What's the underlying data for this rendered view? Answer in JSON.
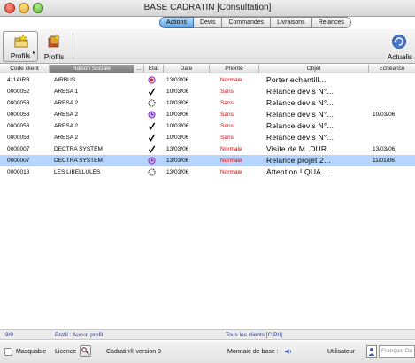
{
  "window": {
    "title": "BASE CADRATIN [Consultation]"
  },
  "tabs": [
    {
      "label": "Actions",
      "active": true
    },
    {
      "label": "Devis",
      "active": false
    },
    {
      "label": "Commandes",
      "active": false
    },
    {
      "label": "Livraisons",
      "active": false
    },
    {
      "label": "Relances",
      "active": false
    }
  ],
  "toolbar": {
    "profils_dropdown_label": "Profils",
    "profils_label": "Profils",
    "actualiser_label": "Actualis"
  },
  "table": {
    "columns": [
      "Code client",
      "Raison Sociale",
      "...",
      "Etat",
      "Date",
      "Priorité",
      "Objet",
      "Echéance"
    ],
    "rows": [
      {
        "code": "411AIRB",
        "raison": "AIRBUS",
        "etat": "clock-red",
        "date": "13/03/06",
        "priorite": "Normale",
        "objet": "Porter echantill...",
        "echeance": "",
        "selected": false
      },
      {
        "code": "0000052",
        "raison": "ARESA 1",
        "etat": "check",
        "date": "10/03/06",
        "priorite": "Sans",
        "objet": "Relance devis N°...",
        "echeance": "",
        "selected": false
      },
      {
        "code": "0000053",
        "raison": "ARESA 2",
        "etat": "clock",
        "date": "10/03/06",
        "priorite": "Sans",
        "objet": "Relance devis N°...",
        "echeance": "",
        "selected": false
      },
      {
        "code": "0000053",
        "raison": "ARESA 2",
        "etat": "clock-purple",
        "date": "10/03/06",
        "priorite": "Sans",
        "objet": "Relance devis N°...",
        "echeance": "10/03/06",
        "selected": false
      },
      {
        "code": "0000053",
        "raison": "ARESA 2",
        "etat": "check",
        "date": "10/03/06",
        "priorite": "Sans",
        "objet": "Relance devis N°...",
        "echeance": "",
        "selected": false
      },
      {
        "code": "0000053",
        "raison": "ARESA 2",
        "etat": "check",
        "date": "10/03/06",
        "priorite": "Sans",
        "objet": "Relance devis N°...",
        "echeance": "",
        "selected": false
      },
      {
        "code": "0000007",
        "raison": "DECTRA SYSTEM",
        "etat": "check",
        "date": "13/03/06",
        "priorite": "Normale",
        "objet": "Visite de M. DUR...",
        "echeance": "13/03/06",
        "selected": false
      },
      {
        "code": "0000007",
        "raison": "DECTRA SYSTEM",
        "etat": "clock-purple",
        "date": "13/03/06",
        "priorite": "Normale",
        "objet": "Relance projet 2...",
        "echeance": "11/01/06",
        "selected": true
      },
      {
        "code": "0000018",
        "raison": "LES LIBELLULES",
        "etat": "clock",
        "date": "13/03/06",
        "priorite": "Normale",
        "objet": "Attention ! QUA...",
        "echeance": "",
        "selected": false
      }
    ]
  },
  "status": {
    "count": "9/9",
    "profil": "Profil :  Aucun profil",
    "filter": "Tous les clients [C/P/I]"
  },
  "bottom": {
    "masquable": "Masquable",
    "licence": "Licence",
    "version": "Cadratin® version 9",
    "monnaie": "Monnaie de base :",
    "utilisateur": "Utilisateur",
    "user_value": "François Du"
  },
  "colors": {
    "selected_row": "#b5d5ff",
    "priority_red": "#d80000",
    "active_tab": "#5b9ee0",
    "status_text": "#2a3a90"
  }
}
